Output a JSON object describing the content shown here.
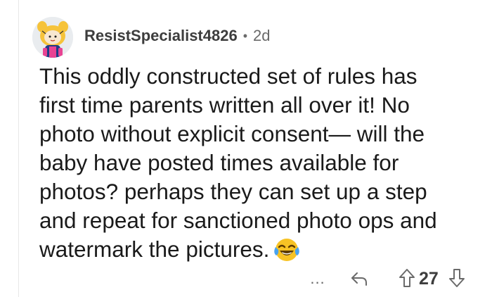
{
  "comment": {
    "author": "ResistSpecialist4826",
    "separator": "•",
    "age": "2d",
    "body_lines": [
      "This oddly constructed set of rules has",
      "first time parents written all over it! No",
      "photo without explicit consent— will the",
      "baby have posted times available for",
      "photos? perhaps they can set up a step",
      "and repeat for sanctioned photo ops and",
      "watermark the pictures."
    ],
    "emoji": "face-with-tears-of-joy"
  },
  "actions": {
    "more": "...",
    "reply_icon": "reply-arrow-icon",
    "upvote_icon": "upvote-arrow-icon",
    "score": "27",
    "downvote_icon": "downvote-arrow-icon"
  },
  "colors": {
    "text": "#1a1a1a",
    "meta": "#6a6a6a",
    "thread_line": "#e8e8e8"
  }
}
